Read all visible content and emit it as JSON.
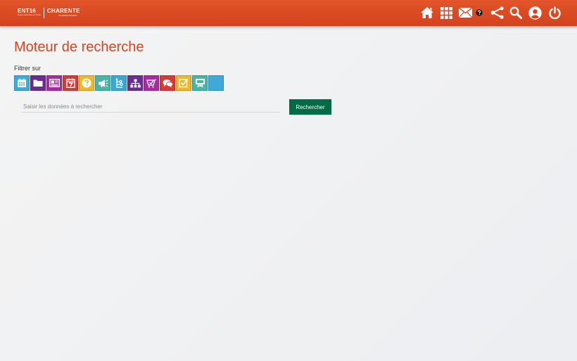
{
  "header": {
    "logo_ent": "ENT16",
    "logo_ent_tagline": "Espace Numérique de Travail",
    "logo_region": "CHARENTE",
    "logo_region_tagline": "LE DÉPARTEMENT",
    "color": "#d4421d",
    "icons": [
      "home-icon",
      "apps-grid-icon",
      "mail-icon",
      "help-icon",
      "share-icon",
      "search-icon",
      "user-account-icon",
      "power-icon"
    ]
  },
  "page": {
    "title": "Moteur de recherche",
    "filter_label": "Filtrer sur"
  },
  "filters": [
    {
      "icon": "calendar-icon",
      "color": "#3fa9d9"
    },
    {
      "icon": "folder-icon",
      "color": "#6a2c8e"
    },
    {
      "icon": "newspaper-icon",
      "color": "#a72ba0"
    },
    {
      "icon": "agenda-icon",
      "color": "#d63a36"
    },
    {
      "icon": "help-question-icon",
      "color": "#ecb92c"
    },
    {
      "icon": "megaphone-icon",
      "color": "#46b6a5"
    },
    {
      "icon": "timeline-icon",
      "color": "#3aa8d2"
    },
    {
      "icon": "sitemap-icon",
      "color": "#6a2c8e"
    },
    {
      "icon": "poll-icon",
      "color": "#a72ba0"
    },
    {
      "icon": "chat-bubbles-icon",
      "color": "#d63a36"
    },
    {
      "icon": "checkbox-icon",
      "color": "#ecb92c"
    },
    {
      "icon": "presentation-icon",
      "color": "#46b6a5"
    },
    {
      "icon": "blank-icon",
      "color": "#3fa9d9"
    }
  ],
  "search": {
    "placeholder": "Saisir les données à rechercher",
    "value": "",
    "button_label": "Rechercher",
    "button_color": "#006b45"
  }
}
